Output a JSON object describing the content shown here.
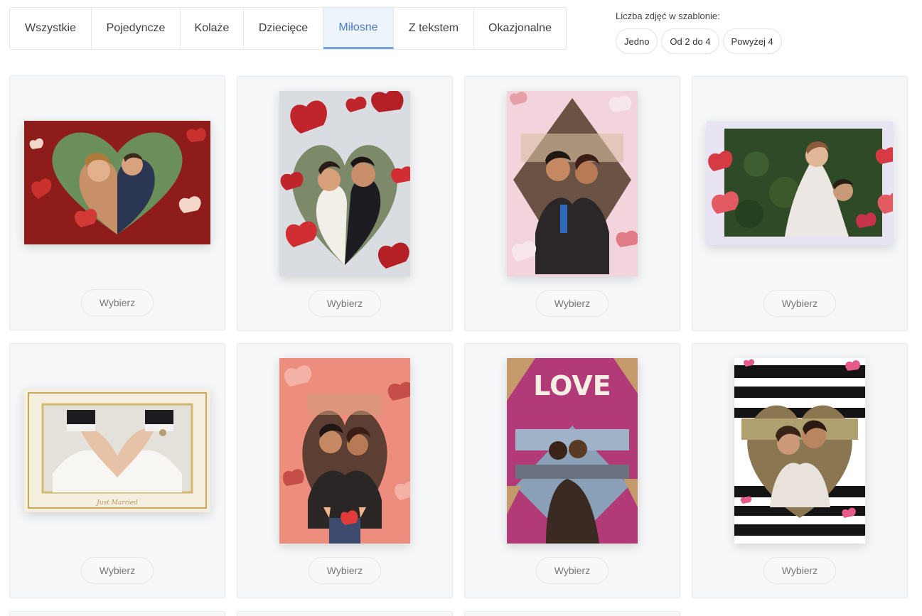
{
  "tabs": [
    {
      "label": "Wszystkie"
    },
    {
      "label": "Pojedyncze"
    },
    {
      "label": "Kolaże"
    },
    {
      "label": "Dziecięce"
    },
    {
      "label": "Miłosne",
      "active": true
    },
    {
      "label": "Z tekstem"
    },
    {
      "label": "Okazjonalne"
    }
  ],
  "filter": {
    "label": "Liczba zdjęć w szablonie:",
    "options": [
      "Jedno",
      "Od 2 do 4",
      "Powyżej 4"
    ]
  },
  "cards": [
    {
      "button": "Wybierz",
      "thumbnail": "red-heart-wedding-landscape"
    },
    {
      "button": "Wybierz",
      "thumbnail": "paper-hearts-wedding-portrait"
    },
    {
      "button": "Wybierz",
      "thumbnail": "pink-diamond-couple-portrait"
    },
    {
      "button": "Wybierz",
      "thumbnail": "hearts-border-couple-landscape"
    },
    {
      "button": "Wybierz",
      "thumbnail": "gold-frame-hands-heart",
      "caption": "Just Married"
    },
    {
      "button": "Wybierz",
      "thumbnail": "floral-heart-couple-portrait"
    },
    {
      "button": "Wybierz",
      "thumbnail": "love-diamond-couple-portrait",
      "caption": "LOVE"
    },
    {
      "button": "Wybierz",
      "thumbnail": "black-stripes-heart-couple"
    }
  ],
  "colors": {
    "accent": "#4a7fc4",
    "active_tab_bg": "#eef4fc",
    "card_bg": "#f6f7f9",
    "border": "#e3e6ea"
  }
}
